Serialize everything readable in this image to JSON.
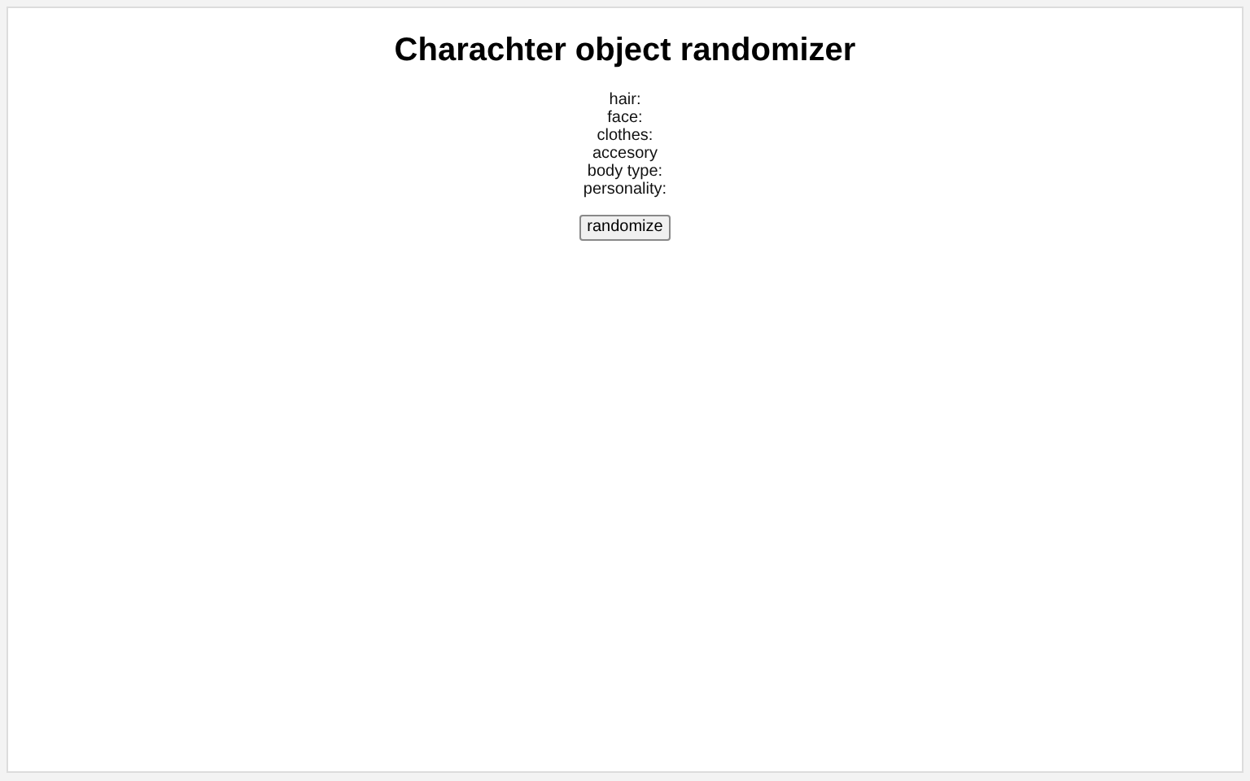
{
  "title": "Charachter object randomizer",
  "fields": [
    "hair:",
    "face:",
    "clothes:",
    "accesory",
    "body type:",
    "personality:"
  ],
  "button": "randomize"
}
